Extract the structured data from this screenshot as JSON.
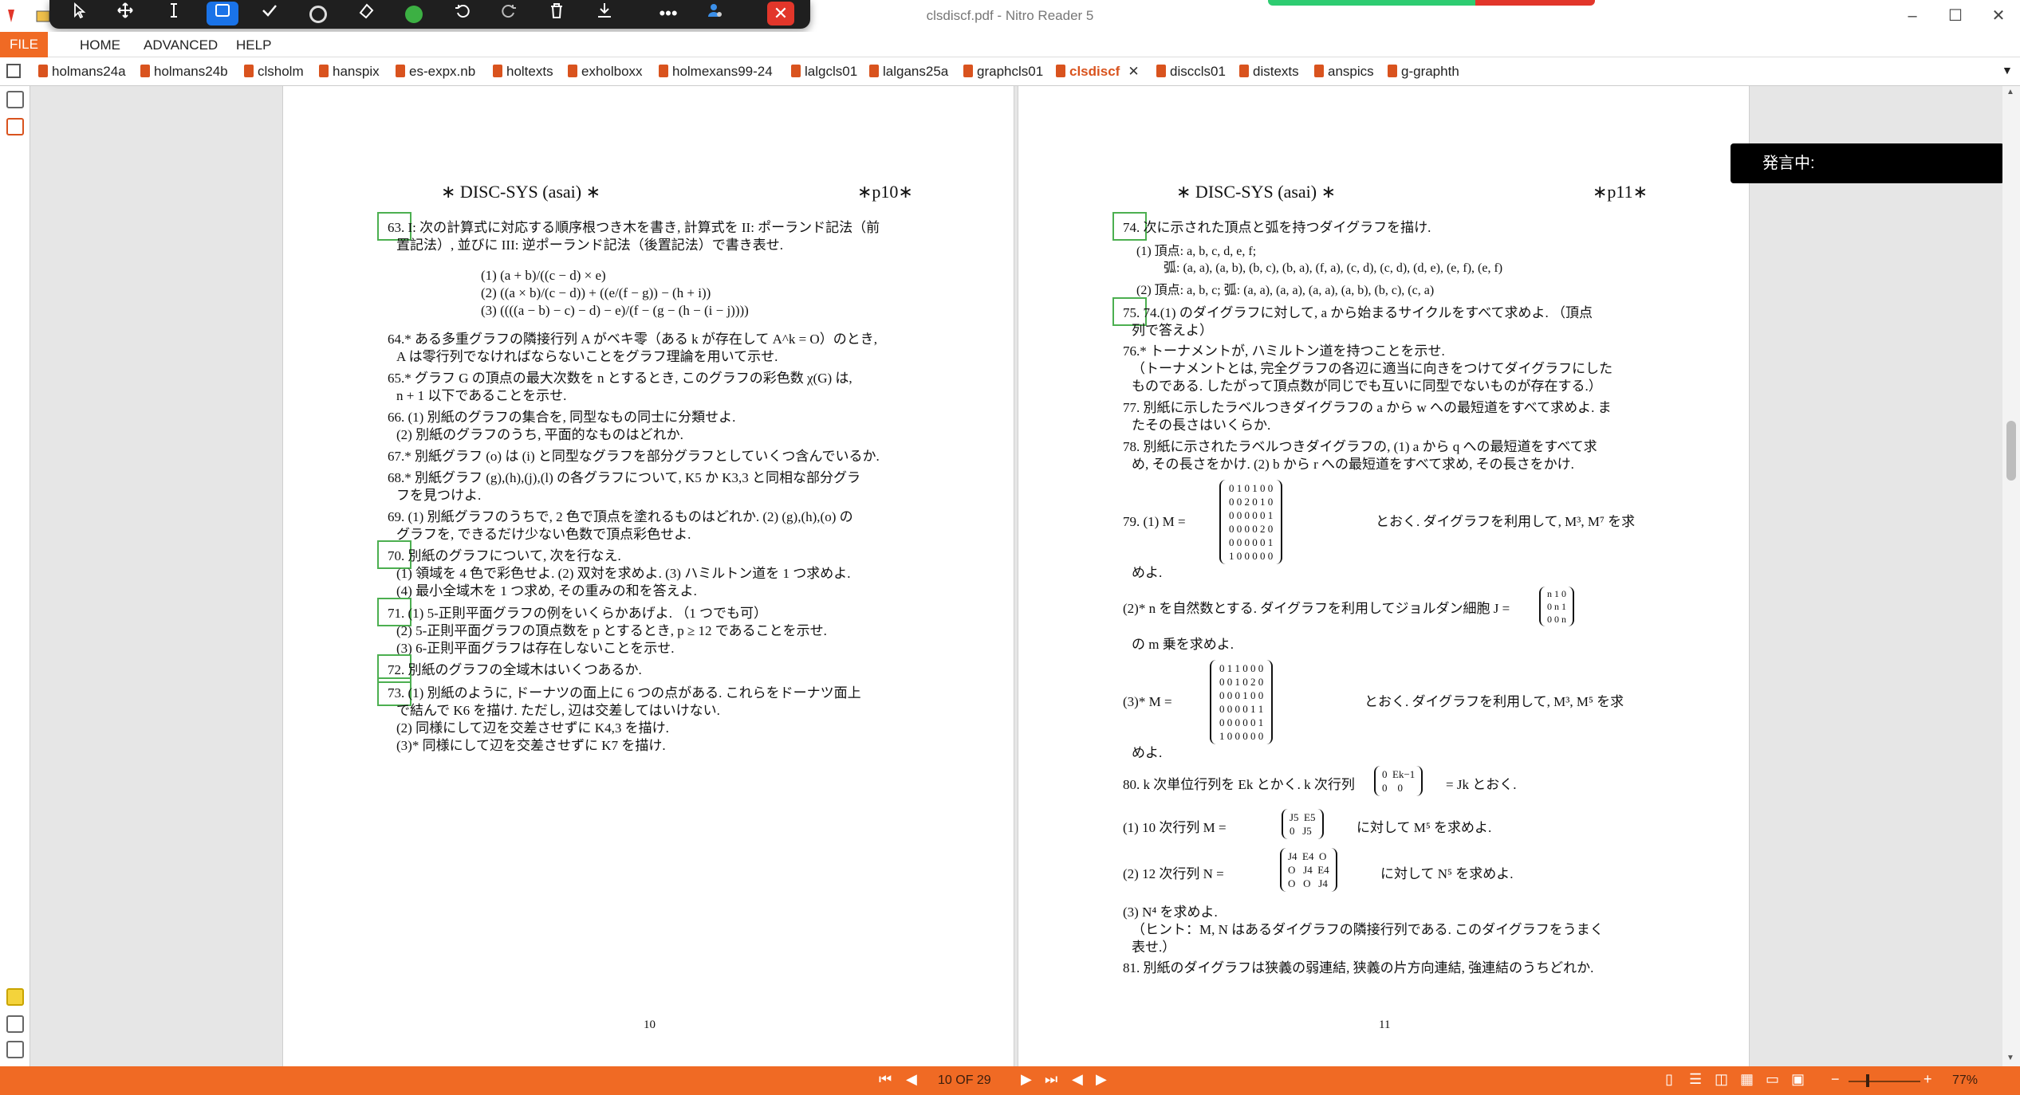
{
  "window": {
    "title": "clsdiscf.pdf - Nitro Reader 5",
    "minimize": "–",
    "maximize": "☐",
    "close": "✕"
  },
  "floating_toolbar": {
    "tools": [
      "select-arrow-icon",
      "pan-move-icon",
      "text-cursor-icon",
      "rectangle-icon",
      "check-icon",
      "stamp-ring-icon",
      "eraser-icon",
      "color-dot-icon",
      "undo-icon",
      "redo-icon",
      "trash-icon",
      "download-icon",
      "more-icon",
      "user-settings-icon",
      "close-icon"
    ],
    "more": "•••",
    "close": "✕"
  },
  "menu": {
    "file": "FILE",
    "home": "HOME",
    "advanced": "ADVANCED",
    "help": "HELP"
  },
  "tabs": [
    {
      "label": "holmans24a"
    },
    {
      "label": "holmans24b"
    },
    {
      "label": "clsholm"
    },
    {
      "label": "hanspix"
    },
    {
      "label": "es-expx.nb"
    },
    {
      "label": "holtexts"
    },
    {
      "label": "exholboxx"
    },
    {
      "label": "holmexans99-24"
    },
    {
      "label": "lalgcls01"
    },
    {
      "label": "lalgans25a"
    },
    {
      "label": "graphcls01"
    },
    {
      "label": "clsdiscf"
    },
    {
      "label": "disccls01"
    },
    {
      "label": "distexts"
    },
    {
      "label": "anspics"
    },
    {
      "label": "g-graphth"
    }
  ],
  "active_tab": "clsdiscf",
  "speaking": {
    "label": "発言中:"
  },
  "left_page": {
    "header_left": "∗ DISC-SYS (asai) ∗",
    "header_right": "∗p10∗",
    "footer": "10",
    "lines": [
      "63. I: 次の計算式に対応する順序根つき木を書き, 計算式を II: ポーランド記法（前",
      "置記法）, 並びに III: 逆ポーランド記法（後置記法）で書き表せ.",
      "(1) (a + b)/((c − d) × e)",
      "(2) ((a × b)/(c − d)) + ((e/(f − g)) − (h + i))",
      "(3) ((((a − b) − c) − d) − e)/(f − (g − (h − (i − j))))",
      "64.* ある多重グラフの隣接行列 A がベキ零（ある k が存在して A^k = O）のとき,",
      "A は零行列でなければならないことをグラフ理論を用いて示せ.",
      "65.* グラフ G の頂点の最大次数を n とするとき, このグラフの彩色数 χ(G) は,",
      "n + 1 以下であることを示せ.",
      "66. (1) 別紙のグラフの集合を, 同型なもの同士に分類せよ.",
      "(2) 別紙のグラフのうち, 平面的なものはどれか.",
      "67.* 別紙グラフ (o) は (i) と同型なグラフを部分グラフとしていくつ含んでいるか.",
      "68.* 別紙グラフ (g),(h),(j),(l) の各グラフについて, K5 か K3,3 と同相な部分グラ",
      "フを見つけよ.",
      "69. (1) 別紙グラフのうちで, 2 色で頂点を塗れるものはどれか. (2) (g),(h),(o) の",
      "グラフを, できるだけ少ない色数で頂点彩色せよ.",
      "70. 別紙のグラフについて, 次を行なえ.",
      "(1) 領域を 4 色で彩色せよ. (2) 双対を求めよ. (3) ハミルトン道を 1 つ求めよ.",
      "(4) 最小全域木を 1 つ求め, その重みの和を答えよ.",
      "71. (1) 5-正則平面グラフの例をいくらかあげよ. （1 つでも可）",
      "(2) 5-正則平面グラフの頂点数を p とするとき, p ≥ 12 であることを示せ.",
      "(3) 6-正則平面グラフは存在しないことを示せ.",
      "72. 別紙のグラフの全域木はいくつあるか.",
      "73. (1) 別紙のように, ドーナツの面上に 6 つの点がある. これらをドーナツ面上",
      "で結んで K6 を描け. ただし, 辺は交差してはいけない.",
      "(2) 同様にして辺を交差させずに K4,3 を描け.",
      "(3)* 同様にして辺を交差させずに K7 を描け."
    ]
  },
  "right_page": {
    "header_left": "∗ DISC-SYS (asai) ∗",
    "header_right": "∗p11∗",
    "footer": "11",
    "lines": [
      "74. 次に示された頂点と弧を持つダイグラフを描け.",
      "(1) 頂点: a, b, c, d, e, f;",
      "弧: (a, a), (a, b), (b, c), (b, a), (f, a), (c, d), (c, d), (d, e), (e, f), (e, f)",
      "(2) 頂点: a, b, c; 弧: (a, a), (a, a), (a, a), (a, b), (b, c), (c, a)",
      "75. 74.(1) のダイグラフに対して, a から始まるサイクルをすべて求めよ. （頂点",
      "列で答えよ）",
      "76.* トーナメントが, ハミルトン道を持つことを示せ.",
      "（トーナメントとは, 完全グラフの各辺に適当に向きをつけてダイグラフにした",
      "ものである. したがって頂点数が同じでも互いに同型でないものが存在する.）",
      "77. 別紙に示したラベルつきダイグラフの a から w への最短道をすべて求めよ. ま",
      "たその長さはいくらか.",
      "78. 別紙に示されたラベルつきダイグラフの, (1) a から q への最短道をすべて求",
      "め, その長さをかけ. (2) b から r への最短道をすべて求め, その長さをかけ.",
      "79. (1) M =",
      "とおく. ダイグラフを利用して, M³, M⁷ を求",
      "めよ.",
      "(2)* n を自然数とする. ダイグラフを利用してジョルダン細胞 J =",
      "の m 乗を求めよ.",
      "(3)* M =",
      "とおく. ダイグラフを利用して, M³, M⁵ を求",
      "めよ.",
      "80. k 次単位行列を Ek とかく. k 次行列",
      "= Jk とおく.",
      "(1) 10 次行列 M =",
      "に対して M⁵ を求めよ.",
      "(2) 12 次行列 N =",
      "に対して N⁵ を求めよ.",
      "(3) N⁴ を求めよ.",
      "（ヒント：M, N はあるダイグラフの隣接行列である. このダイグラフをうまく",
      "表せ.）",
      "81. 別紙のダイグラフは狭義の弱連結, 狭義の片方向連結, 強連結のうちどれか."
    ],
    "matrix_79_1": [
      "0 1 0 1 0 0",
      "0 0 2 0 1 0",
      "0 0 0 0 0 1",
      "0 0 0 0 2 0",
      "0 0 0 0 0 1",
      "1 0 0 0 0 0"
    ],
    "matrix_79_2": [
      "n 1 0",
      "0 n 1",
      "0 0 n"
    ],
    "matrix_79_3": [
      "0 1 1 0 0 0",
      "0 0 1 0 2 0",
      "0 0 0 1 0 0",
      "0 0 0 0 1 1",
      "0 0 0 0 0 1",
      "1 0 0 0 0 0"
    ],
    "matrix_80": [
      "0  Ek−1",
      "0    0"
    ],
    "matrix_80_1": [
      "J5  E5",
      "0   J5"
    ],
    "matrix_80_2": [
      "J4  E4  O",
      "O   J4  E4",
      "O   O   J4"
    ]
  },
  "statusbar": {
    "page_label": "10 OF 29",
    "zoom": "77%",
    "zoom_minus": "−",
    "zoom_plus": "+"
  }
}
